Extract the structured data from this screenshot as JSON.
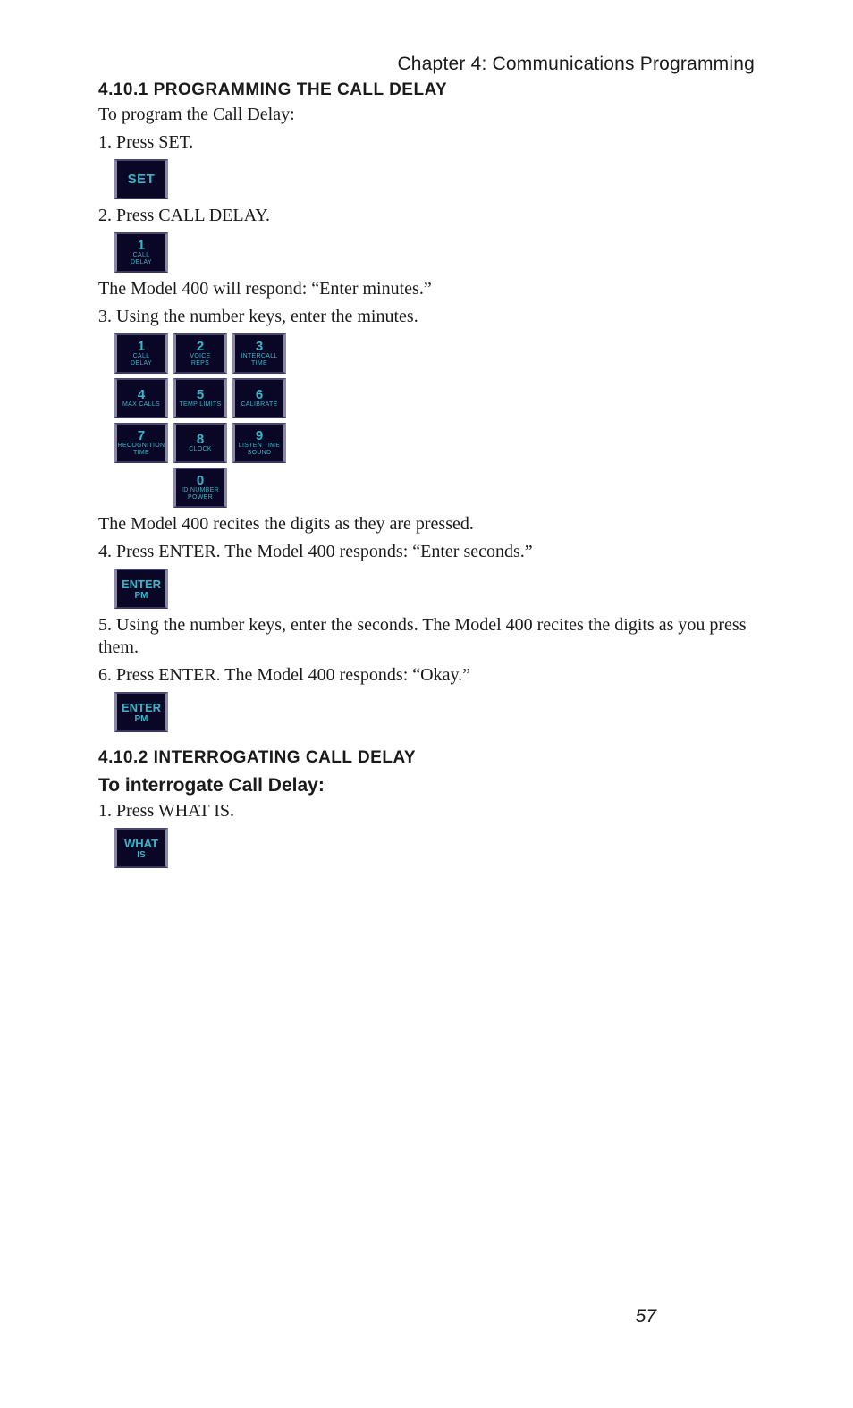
{
  "chapter_header": "Chapter 4: Communications Programming",
  "section_4_10_1": {
    "heading": "4.10.1 PROGRAMMING THE CALL DELAY",
    "intro": "To program the Call Delay:",
    "step1": "1. Press SET.",
    "key_set": "SET",
    "step2": "2. Press CALL DELAY.",
    "key_call_delay": {
      "num": "1",
      "line1": "CALL",
      "line2": "DELAY"
    },
    "response1": "The Model 400 will respond: “Enter minutes.”",
    "step3": "3. Using the number keys, enter the minutes.",
    "keypad": [
      [
        {
          "num": "1",
          "line1": "CALL",
          "line2": "DELAY"
        },
        {
          "num": "2",
          "line1": "VOICE",
          "line2": "REPS"
        },
        {
          "num": "3",
          "line1": "INTERCALL",
          "line2": "TIME"
        }
      ],
      [
        {
          "num": "4",
          "line1": "MAX CALLS",
          "line2": ""
        },
        {
          "num": "5",
          "line1": "TEMP LIMITS",
          "line2": ""
        },
        {
          "num": "6",
          "line1": "CALIBRATE",
          "line2": ""
        }
      ],
      [
        {
          "num": "7",
          "line1": "RECOGNITION",
          "line2": "TIME"
        },
        {
          "num": "8",
          "line1": "CLOCK",
          "line2": ""
        },
        {
          "num": "9",
          "line1": "LISTEN TIME",
          "line2": "SOUND"
        }
      ],
      [
        null,
        {
          "num": "0",
          "line1": "ID NUMBER",
          "line2": "POWER"
        },
        null
      ]
    ],
    "response2": "The Model 400 recites the digits as they are pressed.",
    "step4": "4. Press ENTER. The Model 400 responds: “Enter seconds.”",
    "key_enter": {
      "line1": "ENTER",
      "line2": "PM"
    },
    "step5": "5. Using the number keys, enter the seconds. The Model 400 recites the digits as you press them.",
    "step6": "6. Press ENTER. The Model 400 responds: “Okay.”"
  },
  "section_4_10_2": {
    "heading": "4.10.2 INTERROGATING CALL DELAY",
    "subheading": "To interrogate Call Delay:",
    "step1": "1. Press WHAT IS.",
    "key_whatis": {
      "line1": "WHAT",
      "line2": "IS"
    }
  },
  "page_number": "57"
}
